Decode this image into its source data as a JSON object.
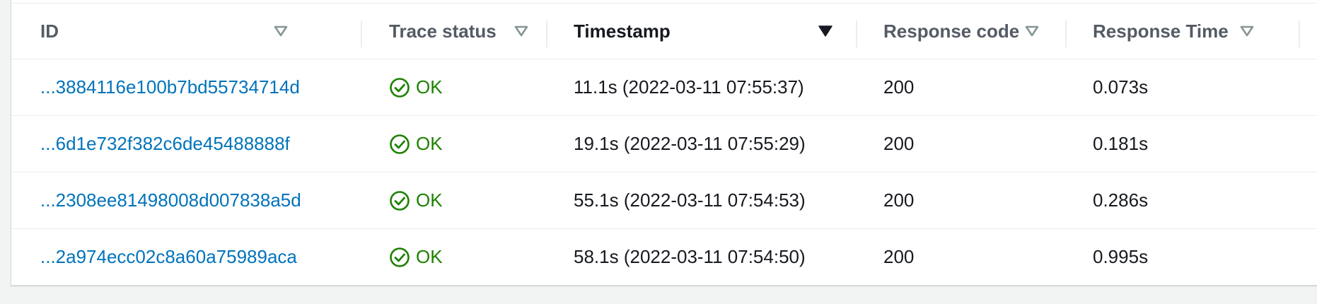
{
  "table": {
    "columns": [
      {
        "label": "ID",
        "sorted": false
      },
      {
        "label": "Trace status",
        "sorted": false
      },
      {
        "label": "Timestamp",
        "sorted": true
      },
      {
        "label": "Response code",
        "sorted": false
      },
      {
        "label": "Response Time",
        "sorted": false
      }
    ],
    "rows": [
      {
        "id": "...3884116e100b7bd55734714d",
        "status": "OK",
        "timestamp": "11.1s (2022-03-11 07:55:37)",
        "response_code": "200",
        "response_time": "0.073s"
      },
      {
        "id": "...6d1e732f382c6de45488888f",
        "status": "OK",
        "timestamp": "19.1s (2022-03-11 07:55:29)",
        "response_code": "200",
        "response_time": "0.181s"
      },
      {
        "id": "...2308ee81498008d007838a5d",
        "status": "OK",
        "timestamp": "55.1s (2022-03-11 07:54:53)",
        "response_code": "200",
        "response_time": "0.286s"
      },
      {
        "id": "...2a974ecc02c8a60a75989aca",
        "status": "OK",
        "timestamp": "58.1s (2022-03-11 07:54:50)",
        "response_code": "200",
        "response_time": "0.995s"
      }
    ]
  },
  "colors": {
    "link": "#0073bb",
    "ok": "#1d8102",
    "header_text": "#545b64",
    "sorted_header_text": "#16191f",
    "sort_icon_inactive": "#879596",
    "sort_icon_active": "#16191f"
  },
  "icons": {
    "sort_inactive": "caret-down-outline-icon",
    "sort_active": "caret-down-filled-icon",
    "status_ok": "check-circle-icon"
  }
}
